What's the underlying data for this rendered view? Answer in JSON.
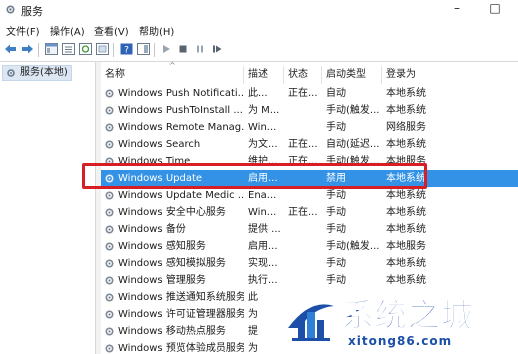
{
  "window": {
    "title": "服务",
    "min": "–",
    "max": "□"
  },
  "menu": [
    "文件(F)",
    "操作(A)",
    "查看(V)",
    "帮助(H)"
  ],
  "tree": {
    "root_label": "服务(本地)"
  },
  "columns": [
    "名称",
    "描述",
    "状态",
    "启动类型",
    "登录为"
  ],
  "services": [
    {
      "name": "Windows Push Notificati...",
      "desc": "此...",
      "status": "正在...",
      "startup": "自动",
      "logon": "本地系统"
    },
    {
      "name": "Windows PushToInstall ...",
      "desc": "为 M...",
      "status": "",
      "startup": "手动(触发...",
      "logon": "本地系统"
    },
    {
      "name": "Windows Remote Manag...",
      "desc": "Win...",
      "status": "",
      "startup": "手动",
      "logon": "网络服务"
    },
    {
      "name": "Windows Search",
      "desc": "为文...",
      "status": "正在...",
      "startup": "自动(延迟...",
      "logon": "本地系统"
    },
    {
      "name": "Windows Time",
      "desc": "维护...",
      "status": "正在...",
      "startup": "手动(触发...",
      "logon": "本地服务"
    },
    {
      "name": "Windows Update",
      "desc": "启用...",
      "status": "",
      "startup": "禁用",
      "logon": "本地系统",
      "selected": true
    },
    {
      "name": "Windows Update Medic ...",
      "desc": "Ena...",
      "status": "",
      "startup": "手动",
      "logon": "本地系统"
    },
    {
      "name": "Windows 安全中心服务",
      "desc": "Win...",
      "status": "正在...",
      "startup": "手动",
      "logon": "本地系统"
    },
    {
      "name": "Windows 备份",
      "desc": "提供 ...",
      "status": "",
      "startup": "手动",
      "logon": "本地系统"
    },
    {
      "name": "Windows 感知服务",
      "desc": "启用...",
      "status": "",
      "startup": "手动(触发...",
      "logon": "本地服务"
    },
    {
      "name": "Windows 感知模拟服务",
      "desc": "实现...",
      "status": "",
      "startup": "手动",
      "logon": "本地系统"
    },
    {
      "name": "Windows 管理服务",
      "desc": "执行...",
      "status": "",
      "startup": "手动",
      "logon": "本地系统"
    },
    {
      "name": "Windows 推送通知系统服务",
      "desc": "此",
      "status": "",
      "startup": "",
      "logon": ""
    },
    {
      "name": "Windows 许可证管理器服务",
      "desc": "为",
      "status": "",
      "startup": "",
      "logon": ""
    },
    {
      "name": "Windows 移动热点服务",
      "desc": "提",
      "status": "",
      "startup": "",
      "logon": ""
    },
    {
      "name": "Windows 预览体验成员服务",
      "desc": "为",
      "status": "",
      "startup": "",
      "logon": ""
    }
  ],
  "watermark": {
    "text": "系统之城",
    "url": "xitong86.com"
  },
  "colors": {
    "selection": "#3391e6",
    "highlight_box": "#d71e24",
    "watermark": "#1b4fa8"
  }
}
